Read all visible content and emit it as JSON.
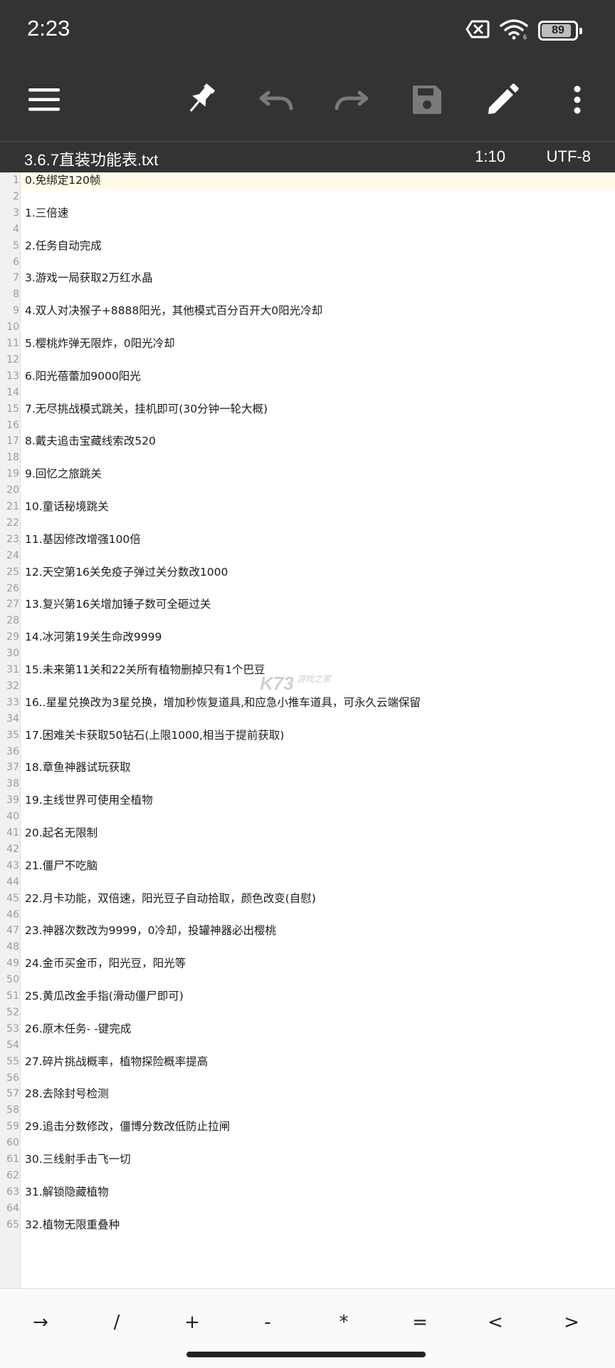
{
  "status_bar": {
    "time": "2:23",
    "battery": "89",
    "battery_level_percent": 89,
    "icons": [
      "sim-off-icon",
      "wifi-icon",
      "battery-icon"
    ]
  },
  "toolbar": {
    "buttons": [
      {
        "name": "menu",
        "icon": "hamburger-menu-icon"
      },
      {
        "name": "pin",
        "icon": "pin-icon"
      },
      {
        "name": "undo",
        "icon": "undo-icon",
        "enabled": false
      },
      {
        "name": "redo",
        "icon": "redo-icon",
        "enabled": false
      },
      {
        "name": "save",
        "icon": "save-icon",
        "enabled": false
      },
      {
        "name": "edit",
        "icon": "pencil-icon"
      },
      {
        "name": "more",
        "icon": "more-vert-icon"
      }
    ]
  },
  "file": {
    "name": "3.6.7直装功能表.txt",
    "position": "1:10",
    "encoding": "UTF-8"
  },
  "editor": {
    "lines": [
      {
        "n": "1",
        "text": "0.免绑定120帧"
      },
      {
        "n": "2",
        "text": ""
      },
      {
        "n": "3",
        "text": "1.三倍速"
      },
      {
        "n": "4",
        "text": ""
      },
      {
        "n": "5",
        "text": "2.任务自动完成"
      },
      {
        "n": "6",
        "text": ""
      },
      {
        "n": "7",
        "text": "3.游戏一局获取2万红水晶"
      },
      {
        "n": "8",
        "text": ""
      },
      {
        "n": "9",
        "text": "4.双人对决猴子+8888阳光，其他模式百分百开大0阳光冷却"
      },
      {
        "n": "10",
        "text": ""
      },
      {
        "n": "11",
        "text": "5.樱桃炸弹无限炸，0阳光冷却"
      },
      {
        "n": "12",
        "text": ""
      },
      {
        "n": "13",
        "text": "6.阳光蓓蕾加9000阳光"
      },
      {
        "n": "14",
        "text": ""
      },
      {
        "n": "15",
        "text": "7.无尽挑战模式跳关，挂机即可(30分钟一轮大概)"
      },
      {
        "n": "16",
        "text": ""
      },
      {
        "n": "17",
        "text": "8.戴夫追击宝藏线索改520"
      },
      {
        "n": "18",
        "text": ""
      },
      {
        "n": "19",
        "text": "9.回忆之旅跳关"
      },
      {
        "n": "20",
        "text": ""
      },
      {
        "n": "21",
        "text": "10.童话秘境跳关"
      },
      {
        "n": "22",
        "text": ""
      },
      {
        "n": "23",
        "text": "11.基因修改增强100倍"
      },
      {
        "n": "24",
        "text": ""
      },
      {
        "n": "25",
        "text": "12.天空第16关免疫子弹过关分数改1000"
      },
      {
        "n": "26",
        "text": ""
      },
      {
        "n": "27",
        "text": "13.复兴第16关增加锤子数可全砸过关"
      },
      {
        "n": "28",
        "text": ""
      },
      {
        "n": "29",
        "text": "14.冰河第19关生命改9999"
      },
      {
        "n": "30",
        "text": ""
      },
      {
        "n": "31",
        "text": "15.未来第11关和22关所有植物删掉只有1个巴豆"
      },
      {
        "n": "32",
        "text": ""
      },
      {
        "n": "33",
        "text": "16..星星兑换改为3星兑换，增加秒恢复道具,和应急小推车道具，可永久云端保留"
      },
      {
        "n": "34",
        "text": ""
      },
      {
        "n": "35",
        "text": "17.困难关卡获取50钻石(上限1000,相当于提前获取)"
      },
      {
        "n": "36",
        "text": ""
      },
      {
        "n": "37",
        "text": "18.章鱼神器试玩获取"
      },
      {
        "n": "38",
        "text": ""
      },
      {
        "n": "39",
        "text": "19.主线世界可使用全植物"
      },
      {
        "n": "40",
        "text": ""
      },
      {
        "n": "41",
        "text": "20.起名无限制"
      },
      {
        "n": "42",
        "text": ""
      },
      {
        "n": "43",
        "text": "21.僵尸不吃脑"
      },
      {
        "n": "44",
        "text": ""
      },
      {
        "n": "45",
        "text": "22.月卡功能，双倍速，阳光豆子自动拾取，颜色改变(自慰)"
      },
      {
        "n": "46",
        "text": ""
      },
      {
        "n": "47",
        "text": "23.神器次数改为9999，0冷却，投罐神器必出樱桃"
      },
      {
        "n": "48",
        "text": ""
      },
      {
        "n": "49",
        "text": "24.金币买金币，阳光豆，阳光等"
      },
      {
        "n": "50",
        "text": ""
      },
      {
        "n": "51",
        "text": "25.黄瓜改金手指(滑动僵尸即可)"
      },
      {
        "n": "52",
        "text": ""
      },
      {
        "n": "53",
        "text": "26.原木任务- -键完成"
      },
      {
        "n": "54",
        "text": ""
      },
      {
        "n": "55",
        "text": "27.碎片挑战概率，植物探险概率提高"
      },
      {
        "n": "56",
        "text": ""
      },
      {
        "n": "57",
        "text": "28.去除封号检测"
      },
      {
        "n": "58",
        "text": ""
      },
      {
        "n": "59",
        "text": "29.追击分数修改，僵博分数改低防止拉闸"
      },
      {
        "n": "60",
        "text": ""
      },
      {
        "n": "61",
        "text": "30.三线射手击飞一切"
      },
      {
        "n": "62",
        "text": ""
      },
      {
        "n": "63",
        "text": "31.解锁隐藏植物"
      },
      {
        "n": "64",
        "text": ""
      },
      {
        "n": "65",
        "text": "32.植物无限重叠种"
      }
    ]
  },
  "watermark": {
    "main": "K73",
    "sub": "游戏之家"
  },
  "symbol_bar": {
    "keys": [
      "→",
      "/",
      "+",
      "-",
      "*",
      "=",
      "<",
      ">"
    ]
  },
  "colors": {
    "chrome": "#333333",
    "current_line": "#fffbe6",
    "gutter": "#f1f1f1"
  }
}
